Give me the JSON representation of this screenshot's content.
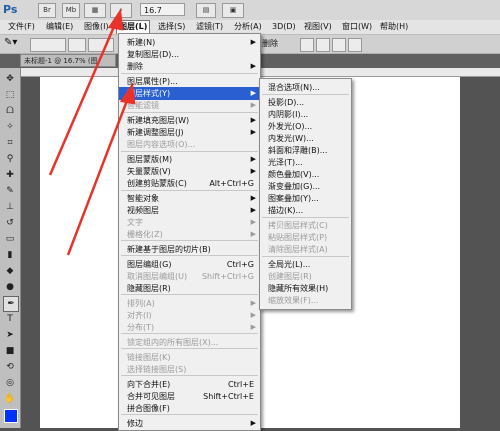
{
  "app": {
    "logo": "Ps"
  },
  "titlebar": {
    "zoom": "16.7"
  },
  "menubar": [
    {
      "label": "文件(F)"
    },
    {
      "label": "编辑(E)"
    },
    {
      "label": "图像(I)"
    },
    {
      "label": "图层(L)"
    },
    {
      "label": "选择(S)"
    },
    {
      "label": "滤镜(T)"
    },
    {
      "label": "分析(A)"
    },
    {
      "label": "3D(D)"
    },
    {
      "label": "视图(V)"
    },
    {
      "label": "窗口(W)"
    },
    {
      "label": "帮助(H)"
    }
  ],
  "options": {
    "remove_label": "删除"
  },
  "document": {
    "tab_title": "未标题-1 @ 16.7% (图"
  },
  "layer_menu": [
    {
      "label": "新建(N)",
      "arrow": true
    },
    {
      "label": "复制图层(D)..."
    },
    {
      "label": "删除",
      "arrow": true
    },
    {
      "label": "图层属性(P)..."
    },
    {
      "label": "图层样式(Y)",
      "arrow": true,
      "highlight": true
    },
    {
      "label": "智能滤镜",
      "disabled": true,
      "arrow": true
    },
    {
      "label": "新建填充图层(W)",
      "arrow": true
    },
    {
      "label": "新建调整图层(J)",
      "arrow": true
    },
    {
      "label": "图层内容选项(O)...",
      "disabled": true
    },
    {
      "label": "图层蒙版(M)",
      "arrow": true
    },
    {
      "label": "矢量蒙版(V)",
      "arrow": true
    },
    {
      "label": "创建剪贴蒙版(C)",
      "shortcut": "Alt+Ctrl+G"
    },
    {
      "label": "智能对象",
      "arrow": true
    },
    {
      "label": "视频图层",
      "arrow": true
    },
    {
      "label": "文字",
      "disabled": true,
      "arrow": true
    },
    {
      "label": "栅格化(Z)",
      "disabled": true,
      "arrow": true
    },
    {
      "label": "新建基于图层的切片(B)"
    },
    {
      "label": "图层编组(G)",
      "shortcut": "Ctrl+G"
    },
    {
      "label": "取消图层编组(U)",
      "shortcut": "Shift+Ctrl+G",
      "disabled": true
    },
    {
      "label": "隐藏图层(R)"
    },
    {
      "label": "排列(A)",
      "disabled": true,
      "arrow": true
    },
    {
      "label": "对齐(I)",
      "disabled": true,
      "arrow": true
    },
    {
      "label": "分布(T)",
      "disabled": true,
      "arrow": true
    },
    {
      "label": "锁定组内的所有图层(X)...",
      "disabled": true
    },
    {
      "label": "链接图层(K)",
      "disabled": true
    },
    {
      "label": "选择链接图层(S)",
      "disabled": true
    },
    {
      "label": "向下合并(E)",
      "shortcut": "Ctrl+E"
    },
    {
      "label": "合并可见图层",
      "shortcut": "Shift+Ctrl+E"
    },
    {
      "label": "拼合图像(F)"
    },
    {
      "label": "修边",
      "arrow": true
    }
  ],
  "style_submenu": [
    {
      "label": "混合选项(N)..."
    },
    {
      "label": "投影(D)..."
    },
    {
      "label": "内阴影(I)..."
    },
    {
      "label": "外发光(O)..."
    },
    {
      "label": "内发光(W)..."
    },
    {
      "label": "斜面和浮雕(B)..."
    },
    {
      "label": "光泽(T)..."
    },
    {
      "label": "颜色叠加(V)..."
    },
    {
      "label": "渐变叠加(G)..."
    },
    {
      "label": "图案叠加(Y)..."
    },
    {
      "label": "描边(K)..."
    },
    {
      "label": "拷贝图层样式(C)",
      "disabled": true
    },
    {
      "label": "粘贴图层样式(P)",
      "disabled": true
    },
    {
      "label": "清除图层样式(A)",
      "disabled": true
    },
    {
      "label": "全局光(L)..."
    },
    {
      "label": "创建图层(R)",
      "disabled": true
    },
    {
      "label": "隐藏所有效果(H)"
    },
    {
      "label": "缩放效果(F)...",
      "disabled": true
    }
  ],
  "colors": {
    "highlight": "#2a5fd1",
    "arrow": "#e8332a",
    "foreground": "#0033ff"
  }
}
